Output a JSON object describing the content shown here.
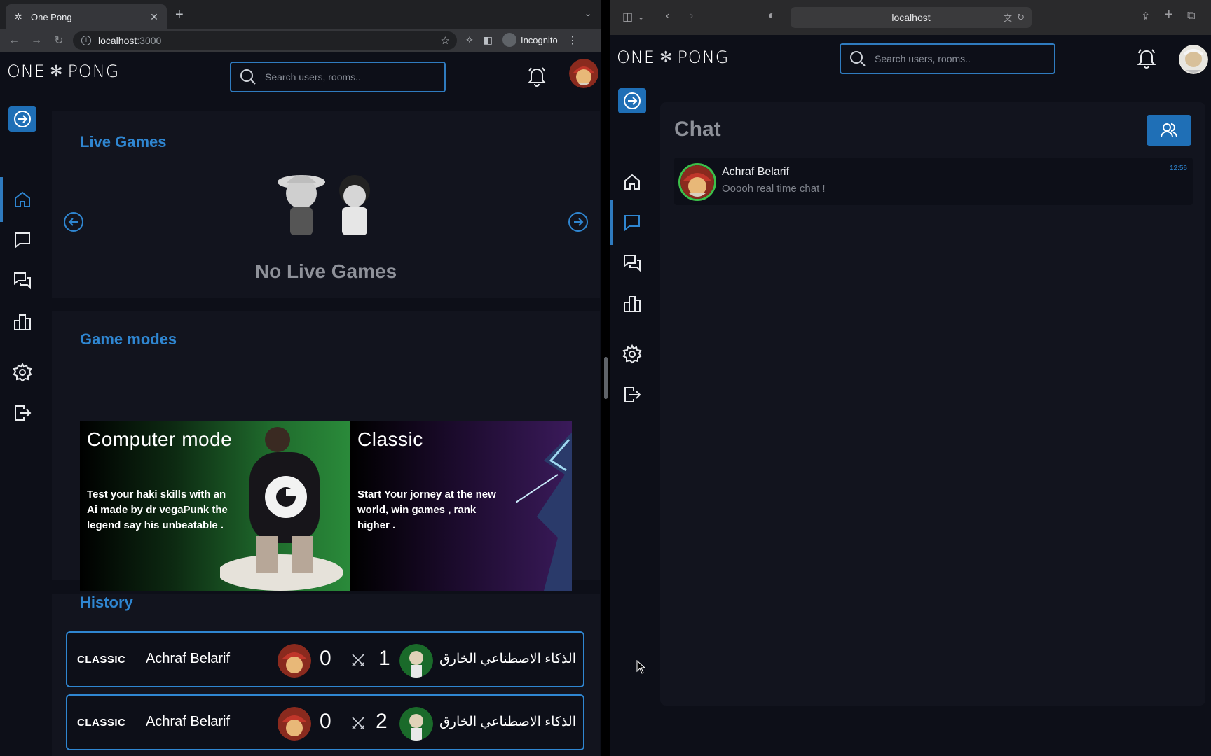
{
  "left_browser": {
    "tab_title": "One Pong",
    "url_host": "localhost",
    "url_port": ":3000",
    "incognito_label": "Incognito"
  },
  "left_app": {
    "logo_left": "ONE",
    "logo_right": "PONG",
    "search_placeholder": "Search users, rooms..",
    "live_games_title": "Live Games",
    "no_live_games": "No Live Games",
    "game_modes_title": "Game modes",
    "modes": [
      {
        "title": "Computer mode",
        "description": "Test your haki skills with an Ai made by dr vegaPunk the legend say his unbeatable ."
      },
      {
        "title": "Classic",
        "description": "Start Your jorney at the new world, win games , rank higher ."
      }
    ],
    "history_title": "History",
    "history": [
      {
        "mode": "CLASSIC",
        "player": "Achraf Belarif",
        "score_left": "0",
        "score_right": "1",
        "opponent": "الذكاء الاصطناعي الخارق"
      },
      {
        "mode": "CLASSIC",
        "player": "Achraf Belarif",
        "score_left": "0",
        "score_right": "2",
        "opponent": "الذكاء الاصطناعي الخارق"
      }
    ]
  },
  "right_browser": {
    "url": "localhost"
  },
  "right_app": {
    "logo_left": "ONE",
    "logo_right": "PONG",
    "search_placeholder": "Search users, rooms..",
    "chat_title": "Chat",
    "conversations": [
      {
        "name": "Achraf Belarif",
        "last_message": "Ooooh real time chat !",
        "time": "12:56"
      }
    ]
  },
  "colors": {
    "accent": "#2f86d1",
    "button": "#1f6fb6",
    "background": "#0d0f18",
    "panel": "#12141e",
    "online": "#3cc04a"
  }
}
